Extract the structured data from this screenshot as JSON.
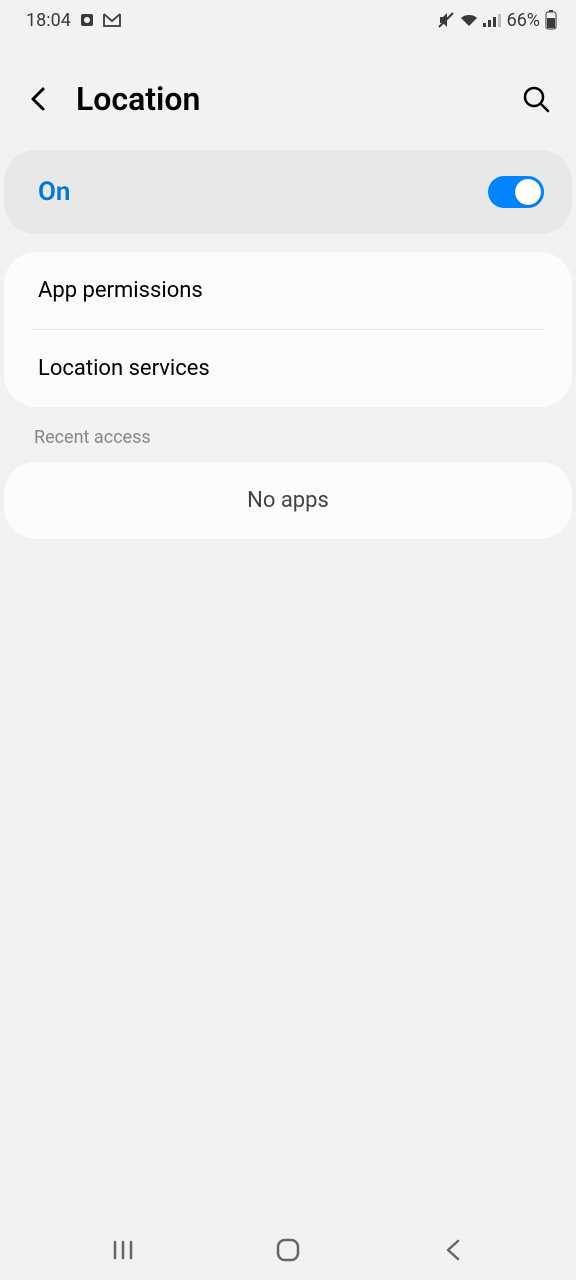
{
  "status": {
    "time": "18:04",
    "battery": "66%"
  },
  "header": {
    "title": "Location"
  },
  "toggle": {
    "label": "On",
    "state": true
  },
  "list": {
    "items": [
      {
        "label": "App permissions"
      },
      {
        "label": "Location services"
      }
    ]
  },
  "recent": {
    "header": "Recent access",
    "empty": "No apps"
  }
}
